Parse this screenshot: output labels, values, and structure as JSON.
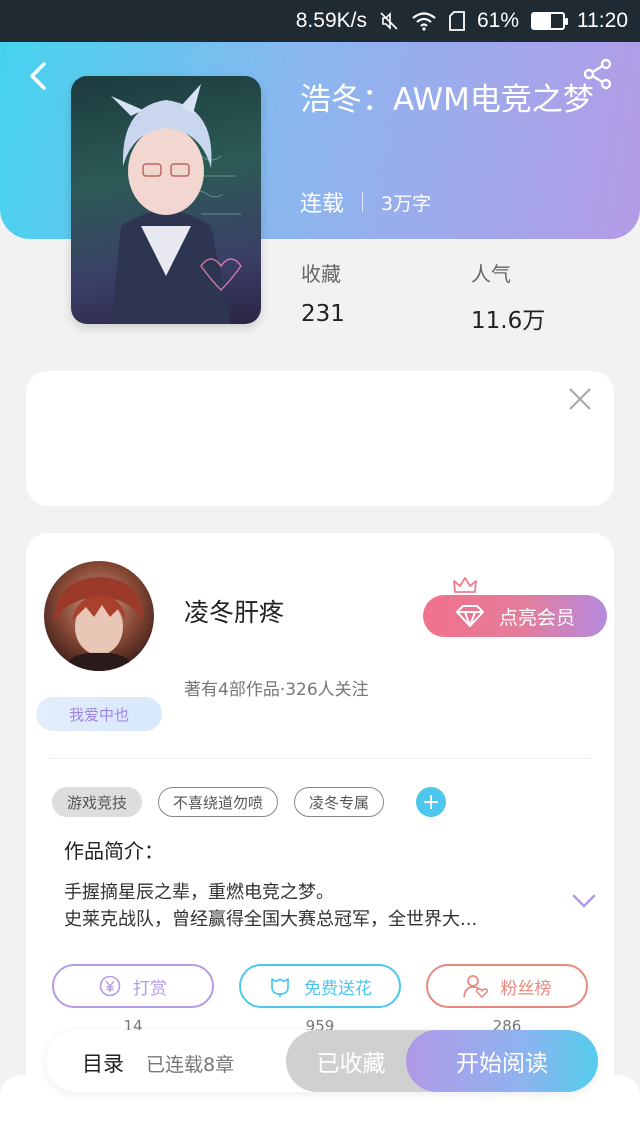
{
  "status_bar": {
    "speed": "8.59K/s",
    "battery_percent": "61%",
    "battery_level": 0.61,
    "time": "11:20"
  },
  "book": {
    "title": "浩冬：AWM电竞之梦",
    "status": "连载",
    "word_count": "3万字",
    "stats": {
      "collect_label": "收藏",
      "collect_value": "231",
      "popularity_label": "人气",
      "popularity_value": "11.6万"
    }
  },
  "author": {
    "name": "凌冬肝疼",
    "stats": "著有4部作品·326人关注",
    "fan_badge": "我爱中也",
    "vip_button": "点亮会员"
  },
  "tags": [
    "游戏竞技",
    "不喜绕道勿喷",
    "凌冬专属"
  ],
  "intro": {
    "title": "作品简介：",
    "line1": "手握摘星辰之辈，重燃电竞之梦。",
    "line2": "史莱克战队，曾经赢得全国大赛总冠军，全世界大..."
  },
  "actions": [
    {
      "label": "打赏",
      "count": "14",
      "color": "#b39be6"
    },
    {
      "label": "免费送花",
      "count": "959",
      "color": "#4ec7ef"
    },
    {
      "label": "粉丝榜",
      "count": "286",
      "color": "#e8877f"
    }
  ],
  "bottom_bar": {
    "toc": "目录",
    "chapters": "已连载8章",
    "collected": "已收藏",
    "read": "开始阅读"
  }
}
